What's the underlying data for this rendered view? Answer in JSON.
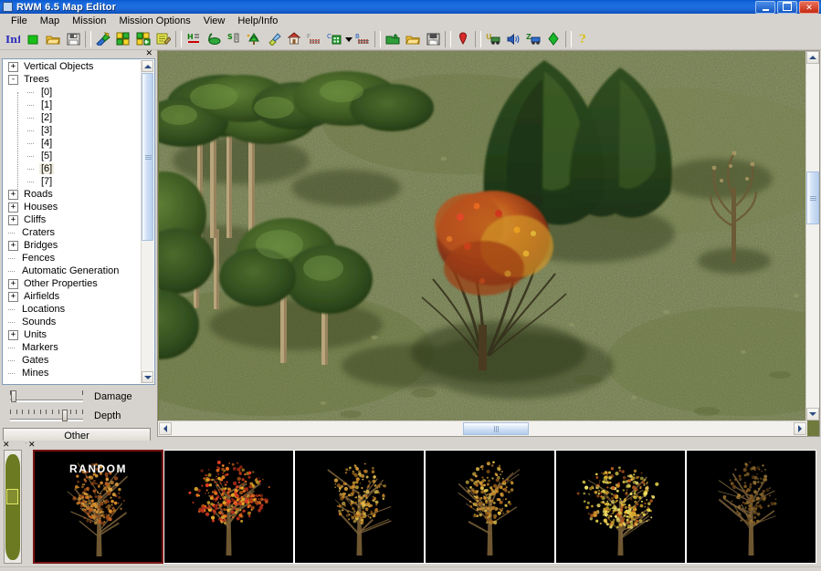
{
  "window": {
    "title": "RWM 6.5 Map Editor",
    "minimize_label": "_",
    "maximize_label": "□",
    "close_label": "✕"
  },
  "menubar": {
    "items": [
      {
        "label": "File"
      },
      {
        "label": "Map"
      },
      {
        "label": "Mission"
      },
      {
        "label": "Mission Options"
      },
      {
        "label": "View"
      },
      {
        "label": "Help/Info"
      }
    ]
  },
  "toolbar": {
    "groups": [
      [
        "info-icon",
        "stop-green-icon",
        "open-folder-icon",
        "save-disk-icon"
      ],
      [
        "terrain-paint-icon",
        "texture-grid-icon",
        "texture-add-icon",
        "edit-note-icon"
      ],
      [
        "height-map-icon",
        "water-icon",
        "slope-icon",
        "tree-place-icon",
        "brush-icon",
        "house-icon",
        "fence-icon",
        "city-icon",
        "dropdown-arrow-icon",
        "bridge-icon"
      ],
      [
        "import-icon",
        "open-mission-icon",
        "save-mission-icon"
      ],
      [
        "marker-icon"
      ],
      [
        "unit-icon",
        "sound-icon",
        "zone-icon",
        "compass-icon"
      ],
      [
        "help-icon"
      ]
    ]
  },
  "objects_panel": {
    "close_label": "✕",
    "tree": [
      {
        "label": "Vertical Objects",
        "level": 0,
        "expander": "+",
        "selected": false
      },
      {
        "label": "Trees",
        "level": 0,
        "expander": "-",
        "selected": false
      },
      {
        "label": "[0]",
        "level": 1,
        "expander": "",
        "selected": false
      },
      {
        "label": "[1]",
        "level": 1,
        "expander": "",
        "selected": false
      },
      {
        "label": "[2]",
        "level": 1,
        "expander": "",
        "selected": false
      },
      {
        "label": "[3]",
        "level": 1,
        "expander": "",
        "selected": false
      },
      {
        "label": "[4]",
        "level": 1,
        "expander": "",
        "selected": false
      },
      {
        "label": "[5]",
        "level": 1,
        "expander": "",
        "selected": false
      },
      {
        "label": "[6]",
        "level": 1,
        "expander": "",
        "selected": true
      },
      {
        "label": "[7]",
        "level": 1,
        "expander": "",
        "selected": false
      },
      {
        "label": "Roads",
        "level": 0,
        "expander": "+",
        "selected": false
      },
      {
        "label": "Houses",
        "level": 0,
        "expander": "+",
        "selected": false
      },
      {
        "label": "Cliffs",
        "level": 0,
        "expander": "+",
        "selected": false
      },
      {
        "label": "Craters",
        "level": 0,
        "expander": "",
        "selected": false
      },
      {
        "label": "Bridges",
        "level": 0,
        "expander": "+",
        "selected": false
      },
      {
        "label": "Fences",
        "level": 0,
        "expander": "",
        "selected": false
      },
      {
        "label": "Automatic Generation",
        "level": 0,
        "expander": "",
        "selected": false
      },
      {
        "label": "Other Properties",
        "level": 0,
        "expander": "+",
        "selected": false
      },
      {
        "label": "Airfields",
        "level": 0,
        "expander": "+",
        "selected": false
      },
      {
        "label": "Locations",
        "level": 0,
        "expander": "",
        "selected": false
      },
      {
        "label": "Sounds",
        "level": 0,
        "expander": "",
        "selected": false
      },
      {
        "label": "Units",
        "level": 0,
        "expander": "+",
        "selected": false
      },
      {
        "label": "Markers",
        "level": 0,
        "expander": "",
        "selected": false
      },
      {
        "label": "Gates",
        "level": 0,
        "expander": "",
        "selected": false
      },
      {
        "label": "Mines",
        "level": 0,
        "expander": "",
        "selected": false
      }
    ],
    "sliders": [
      {
        "label": "Damage",
        "ticks": false,
        "thumb_pct": 2
      },
      {
        "label": "Depth",
        "ticks": true,
        "thumb_pct": 72
      }
    ],
    "other_button": "Other"
  },
  "map_view": {
    "h_scroll_thumb_pct": 50,
    "v_scroll_thumb_pct": 33,
    "left_arrow": "‹",
    "right_arrow": "›",
    "up_arrow": "^",
    "down_arrow": "v"
  },
  "minimap_panel": {
    "close_label": "✕"
  },
  "thumbnail_panel": {
    "close_label": "✕",
    "thumbnails": [
      {
        "name": "random",
        "label": "RANDOM",
        "selected": true,
        "foliage": "sparse-orange",
        "seed": 1
      },
      {
        "name": "tree-0",
        "label": "",
        "selected": false,
        "foliage": "red-orange-full",
        "seed": 2
      },
      {
        "name": "tree-1",
        "label": "",
        "selected": false,
        "foliage": "bare-gold",
        "seed": 3
      },
      {
        "name": "tree-2",
        "label": "",
        "selected": false,
        "foliage": "thin-gold",
        "seed": 4
      },
      {
        "name": "tree-3",
        "label": "",
        "selected": false,
        "foliage": "dense-yellow",
        "seed": 5
      },
      {
        "name": "tree-4",
        "label": "",
        "selected": false,
        "foliage": "dark-sparse",
        "seed": 6
      }
    ]
  },
  "colors": {
    "titlebar_blue": "#1f6fe0",
    "panel_gray": "#d6d3ce",
    "grass_green": "#6f7b3b",
    "selection_red": "#7a1414",
    "tree_select_highlight": "#f2eee1"
  }
}
